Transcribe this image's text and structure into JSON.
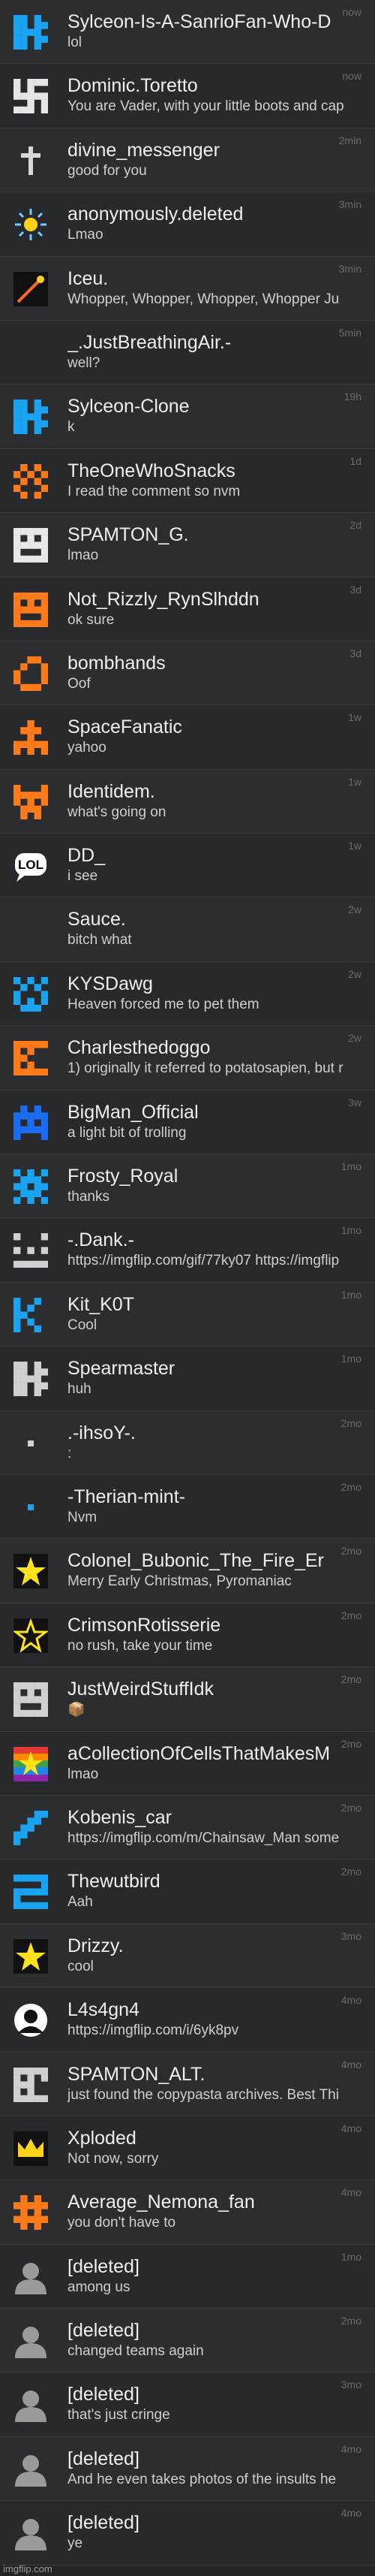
{
  "watermark": "imgflip.com",
  "rows": [
    {
      "user": "Sylceon-Is-A-SanrioFan-Who-D",
      "msg": "lol",
      "time": "now",
      "icon": "pixel-blue-s",
      "color": "#1aa3f0"
    },
    {
      "user": "Dominic.Toretto",
      "msg": "You are Vader, with your little boots and cap",
      "time": "now",
      "icon": "swastika-shape",
      "color": "#e6e6e6"
    },
    {
      "user": "divine_messenger",
      "msg": "good for you",
      "time": "2min",
      "icon": "cross",
      "color": "#d8d8d8"
    },
    {
      "user": "anonymously.deleted",
      "msg": "Lmao",
      "time": "3min",
      "icon": "sun",
      "color": "#6fd0ff"
    },
    {
      "user": "Iceu.",
      "msg": "Whopper, Whopper, Whopper, Whopper Ju",
      "time": "3min",
      "icon": "shooting-star",
      "color": "#ff6a1a"
    },
    {
      "user": "_.JustBreathingAir.-",
      "msg": "well?",
      "time": "5min",
      "icon": "none",
      "color": "#2c2d30"
    },
    {
      "user": "Sylceon-Clone",
      "msg": "k",
      "time": "19h",
      "icon": "pixel-blue-s",
      "color": "#1aa3f0"
    },
    {
      "user": "TheOneWhoSnacks",
      "msg": "I read the comment so nvm",
      "time": "1d",
      "icon": "pixel-orange",
      "color": "#ff7a1a"
    },
    {
      "user": "SPAMTON_G.",
      "msg": "lmao",
      "time": "2d",
      "icon": "pixel-face",
      "color": "#e8e8e8"
    },
    {
      "user": "Not_Rizzly_RynSlhddn",
      "msg": "ok sure",
      "time": "3d",
      "icon": "pixel-orange-face",
      "color": "#ff7a1a"
    },
    {
      "user": "bombhands",
      "msg": "Oof",
      "time": "3d",
      "icon": "pixel-orange-ring",
      "color": "#ff7a1a"
    },
    {
      "user": "SpaceFanatic",
      "msg": "yahoo",
      "time": "1w",
      "icon": "pixel-orange-t",
      "color": "#ff7a1a"
    },
    {
      "user": "Identidem.",
      "msg": "what's going on",
      "time": "1w",
      "icon": "pixel-orange-cup",
      "color": "#ff7a1a"
    },
    {
      "user": "DD_",
      "msg": "i see",
      "time": "1w",
      "icon": "lol-bubble",
      "color": "#ffffff"
    },
    {
      "user": "Sauce.",
      "msg": "bitch what",
      "time": "2w",
      "icon": "none",
      "color": "#2c2d30"
    },
    {
      "user": "KYSDawg",
      "msg": "Heaven forced me to pet them",
      "time": "2w",
      "icon": "pixel-blue-face",
      "color": "#1aa3f0"
    },
    {
      "user": "Charlesthedoggo",
      "msg": "1) originally it referred to potatosapien, but r",
      "time": "2w",
      "icon": "pixel-orange-c",
      "color": "#ff7a1a"
    },
    {
      "user": "BigMan_Official",
      "msg": "a light bit of trolling",
      "time": "3w",
      "icon": "pixel-blue-invader",
      "color": "#1a6cf0"
    },
    {
      "user": "Frosty_Royal",
      "msg": "thanks",
      "time": "1mo",
      "icon": "pixel-blue-cross",
      "color": "#1aa3f0"
    },
    {
      "user": "-.Dank.-",
      "msg": "https://imgflip.com/gif/77ky07 https://imgflip",
      "time": "1mo",
      "icon": "pixel-grey-face",
      "color": "#d0d0d0"
    },
    {
      "user": "Kit_K0T",
      "msg": "Cool",
      "time": "1mo",
      "icon": "pixel-blue-k",
      "color": "#1aa3f0"
    },
    {
      "user": "Spearmaster",
      "msg": "huh",
      "time": "1mo",
      "icon": "pixel-grey-s",
      "color": "#d0d0d0"
    },
    {
      "user": ".-ihsoY-.",
      "msg": ":",
      "time": "2mo",
      "icon": "dot",
      "color": "#d0d0d0"
    },
    {
      "user": "-Therian-mint-",
      "msg": "Nvm",
      "time": "2mo",
      "icon": "dot",
      "color": "#1aa3f0"
    },
    {
      "user": "Colonel_Bubonic_The_Fire_Er",
      "msg": "Merry Early Christmas, Pyromaniac",
      "time": "2mo",
      "icon": "star",
      "color": "#ffe21a"
    },
    {
      "user": "CrimsonRotisserie",
      "msg": "no rush, take your time",
      "time": "2mo",
      "icon": "star-outline",
      "color": "#ffe21a"
    },
    {
      "user": "JustWeirdStuffIdk",
      "msg": "📦",
      "time": "2mo",
      "icon": "pixel-grey-box",
      "color": "#d0d0d0"
    },
    {
      "user": "aCollectionOfCellsThatMakesM",
      "msg": "lmao",
      "time": "2mo",
      "icon": "rainbow-star",
      "color": "#ffe21a"
    },
    {
      "user": "Kobenis_car",
      "msg": "https://imgflip.com/m/Chainsaw_Man some",
      "time": "2mo",
      "icon": "pixel-blue-diag",
      "color": "#1aa3f0"
    },
    {
      "user": "Thewutbird",
      "msg": "Aah",
      "time": "2mo",
      "icon": "pixel-blue-s2",
      "color": "#1aa3f0"
    },
    {
      "user": "Drizzy.",
      "msg": "cool",
      "time": "3mo",
      "icon": "star",
      "color": "#ffe21a"
    },
    {
      "user": "L4s4gn4",
      "msg": "https://imgflip.com/i/6yk8pv",
      "time": "4mo",
      "icon": "person-circle",
      "color": "#ffffff"
    },
    {
      "user": "SPAMTON_ALT.",
      "msg": "just found the copypasta archives. Best Thi",
      "time": "4mo",
      "icon": "pixel-grey-face2",
      "color": "#d0d0d0"
    },
    {
      "user": "Xploded",
      "msg": "Not now, sorry",
      "time": "4mo",
      "icon": "crown",
      "color": "#ffd21a"
    },
    {
      "user": "Average_Nemona_fan",
      "msg": "you don't have to",
      "time": "4mo",
      "icon": "pixel-orange-hash",
      "color": "#ff7a1a"
    },
    {
      "user": "[deleted]",
      "msg": "among us",
      "time": "1mo",
      "icon": "default-user",
      "color": "#9a9a9a"
    },
    {
      "user": "[deleted]",
      "msg": "changed teams again",
      "time": "2mo",
      "icon": "default-user",
      "color": "#9a9a9a"
    },
    {
      "user": "[deleted]",
      "msg": "that's just cringe",
      "time": "3mo",
      "icon": "default-user",
      "color": "#9a9a9a"
    },
    {
      "user": "[deleted]",
      "msg": "And he even takes photos of the insults he",
      "time": "4mo",
      "icon": "default-user",
      "color": "#9a9a9a"
    },
    {
      "user": "[deleted]",
      "msg": "ye",
      "time": "4mo",
      "icon": "default-user",
      "color": "#9a9a9a"
    }
  ]
}
